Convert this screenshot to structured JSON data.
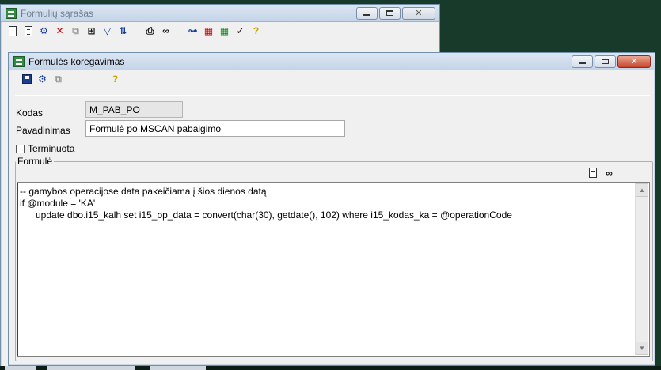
{
  "back_window": {
    "title": "Formulių sąrašas",
    "toolbar": [
      "new-document-icon",
      "document-icon",
      "options-icon",
      "delete-icon",
      "copy-icon",
      "tree-icon",
      "filter-icon",
      "sort-az-icon",
      "print-icon",
      "find-binoculars-icon",
      "hierarchy-icon",
      "bag-red-icon",
      "bag-green-icon",
      "checkmark-icon",
      "help-icon"
    ]
  },
  "editor_window": {
    "title": "Formulės koregavimas",
    "toolbar": [
      "save-icon",
      "options-icon",
      "copy-icon",
      "help-icon"
    ],
    "fields": {
      "kodas_label": "Kodas",
      "kodas_value": "M_PAB_PO",
      "pavadinimas_label": "Pavadinimas",
      "pavadinimas_value": "Formulė po MSCAN pabaigimo",
      "terminuota_label": "Terminuota"
    },
    "formula_group": {
      "legend": "Formulė",
      "code_lines": [
        "-- gamybos operacijose data pakeičiama į šios dienos datą",
        "if @module = 'KA'",
        "      update dbo.i15_kalh set i15_op_data = convert(char(30), getdate(), 102) where i15_kodas_ka = @operationCode"
      ]
    }
  },
  "colors": {
    "desktop": "#173a2a",
    "window_bg": "#f0f0f0",
    "title_gradient_top": "#dbe6f3",
    "close_button": "#c8452c"
  }
}
